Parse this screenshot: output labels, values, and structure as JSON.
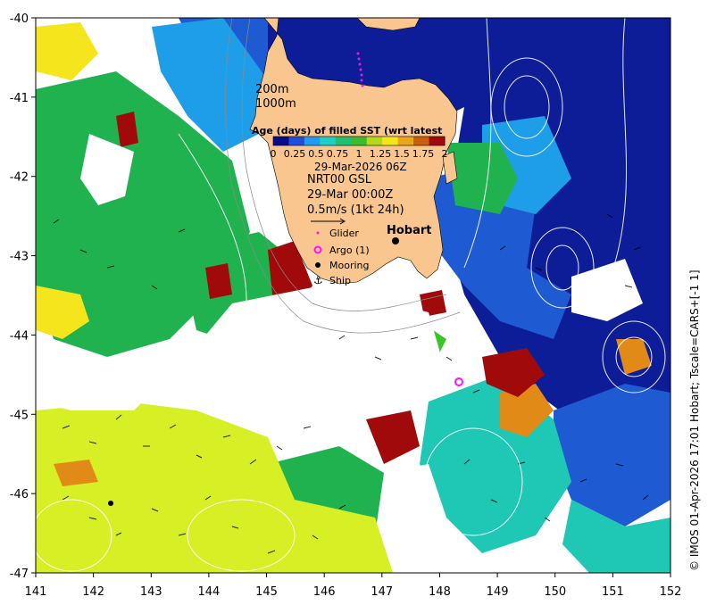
{
  "map": {
    "lon_ticks": [
      "141",
      "142",
      "143",
      "144",
      "145",
      "146",
      "147",
      "148",
      "149",
      "150",
      "151",
      "152"
    ],
    "lat_ticks": [
      "-40",
      "-41",
      "-42",
      "-43",
      "-44",
      "-45",
      "-46",
      "-47"
    ],
    "lon_range": [
      141,
      152
    ],
    "lat_range": [
      -47,
      -40
    ]
  },
  "legend": {
    "depth_200": "200m",
    "depth_1000": "1000m",
    "colorbar_title": "Age (days) of filled SST (wrt latest",
    "colorbar_ticks": [
      "0",
      "0.25",
      "0.5",
      "0.75",
      "1",
      "1.25",
      "1.5",
      "1.75",
      "2"
    ],
    "colorbar_colors": [
      "#0a0a8c",
      "#1f4fd6",
      "#1f9bef",
      "#1fcfc4",
      "#20c070",
      "#3dba2e",
      "#b6d81a",
      "#f3e71a",
      "#e8a81a",
      "#c8600e",
      "#a00a0a"
    ],
    "sst_date": "29-Mar-2026 06Z",
    "currents_source": "NRT00 GSL",
    "currents_date": "29-Mar 00:00Z",
    "vector_scale": "0.5m/s (1kt 24h)",
    "glider": "Glider",
    "argo": "Argo (1)",
    "mooring": "Mooring",
    "ship": "Ship"
  },
  "places": {
    "hobart": "Hobart"
  },
  "credit": "© IMOS 01-Apr-2026 17:01 Hobart; Tscale=CARS+[-1 1]",
  "colors": {
    "land": "#f9c68f",
    "ocean_white": "#ffffff",
    "deep_blue": "#0d1d98",
    "blue": "#1e5ad2",
    "light_blue": "#1e9ee8",
    "teal": "#1ec8b4",
    "green": "#21b250",
    "bright_green": "#3cc32a",
    "yellow_green": "#d6f025",
    "yellow": "#f5e51c",
    "orange": "#e28a18",
    "dark_red": "#a0100a",
    "glider": "#e020e0",
    "argo": "#ff10ff"
  }
}
